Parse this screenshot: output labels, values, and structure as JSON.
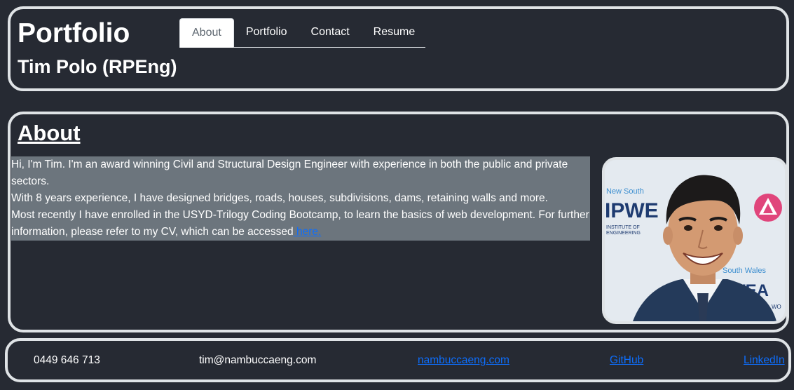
{
  "header": {
    "title": "Portfolio",
    "subtitle": "Tim Polo (RPEng)",
    "nav": [
      {
        "label": "About",
        "active": true
      },
      {
        "label": "Portfolio",
        "active": false
      },
      {
        "label": "Contact",
        "active": false
      },
      {
        "label": "Resume",
        "active": false
      }
    ]
  },
  "about": {
    "heading": "About",
    "paragraphs": [
      "Hi, I'm Tim. I'm an award winning Civil and Structural Design Engineer with experience in both the public and private sectors.",
      "With 8 years experience, I have designed bridges, roads, houses, subdivisions, dams, retaining walls and more.",
      "Most recently I have enrolled in the USYD-Trilogy Coding Bootcamp, to learn the basics of web development. For further information, please refer to my CV, which can be accessed"
    ],
    "cv_link_label": " here.",
    "photo": {
      "backdrop_text": {
        "line1": "New South",
        "line2": "IPWE",
        "line3": "INSTITUTE OF",
        "line4": "ENGINEERING",
        "line5": "South Wales",
        "line6": "WEA",
        "line7": "WO"
      }
    }
  },
  "footer": {
    "phone": "0449 646 713",
    "email": "tim@nambuccaeng.com",
    "website": "nambuccaeng.com",
    "github": "GitHub",
    "linkedin": "LinkedIn"
  },
  "colors": {
    "background": "#262a33",
    "panel_border": "#dfe3e6",
    "text_highlight": "#6c757d",
    "link": "#0d6efd"
  }
}
